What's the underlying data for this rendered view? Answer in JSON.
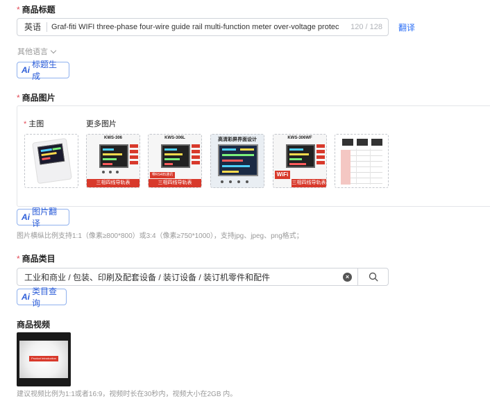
{
  "title_section": {
    "label": "商品标题",
    "lang_prefix": "英语",
    "value": "Graf-fiti WIFI three-phase four-wire guide rail multi-function meter over-voltage protec",
    "count": "120 / 128",
    "translate": "翻译",
    "other_lang": "其他语言",
    "ai_button": "标题生成"
  },
  "image_section": {
    "label": "商品图片",
    "main_label": "主图",
    "more_label": "更多图片",
    "ai_button": "图片翻译",
    "hint": "图片横纵比例支持1:1（像素≥800*800）或3:4（像素≥750*1000），支持jpg、jpeg、png格式；",
    "thumbs": [
      {
        "model": "KWS-306",
        "band": "三相四线导轨表"
      },
      {
        "model": "KWS-306L",
        "band": "三相四线导轨表",
        "tag": "带RS485通讯"
      },
      {
        "model": "高清彩屏界面设计"
      },
      {
        "model": "KWS-306WF",
        "band": "三相四线导轨表",
        "tag": "WiFi"
      }
    ]
  },
  "category_section": {
    "label": "商品类目",
    "value": "工业和商业 / 包装、印刷及配套设备 / 装订设备 / 装订机零件和配件",
    "ai_button": "类目查询"
  },
  "video_section": {
    "label": "商品视频",
    "video_label": "Product Introduction",
    "hint": "建议视频比例为1:1或者16:9，视频时长在30秒内，视频大小在2GB 内。"
  },
  "ai_mark": "Ai",
  "colors": {
    "accent": "#2c6ff6",
    "required": "#e34d59",
    "banner_red": "#d8392b"
  }
}
